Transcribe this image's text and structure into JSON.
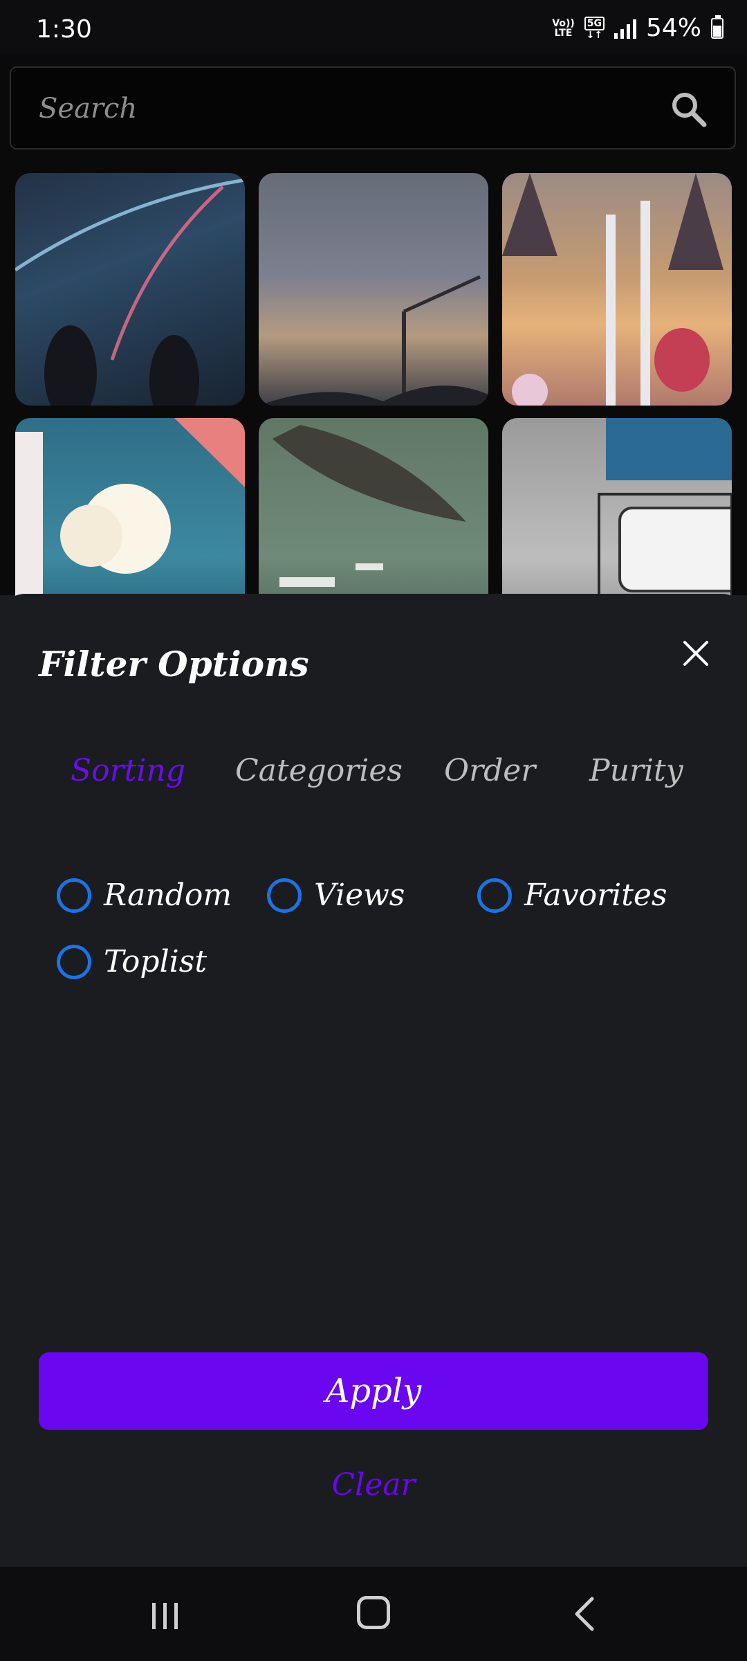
{
  "status_bar": {
    "time": "1:30",
    "volte_label_top": "Vo))",
    "volte_label_bottom": "LTE",
    "network_label": "5G",
    "battery": "54%"
  },
  "search": {
    "placeholder": "Search",
    "icon": "search-icon"
  },
  "sheet": {
    "title": "Filter Options",
    "close_icon": "close-icon",
    "tabs": [
      {
        "label": "Sorting",
        "active": true
      },
      {
        "label": "Categories",
        "active": false
      },
      {
        "label": "Order",
        "active": false
      },
      {
        "label": "Purity",
        "active": false
      }
    ],
    "options": [
      {
        "label": "Random",
        "selected": false
      },
      {
        "label": "Views",
        "selected": false
      },
      {
        "label": "Favorites",
        "selected": false
      },
      {
        "label": "Toplist",
        "selected": false
      }
    ],
    "apply_label": "Apply",
    "clear_label": "Clear"
  },
  "colors": {
    "accent": "#6a06f0",
    "radio": "#1a73e8",
    "sheet_bg": "#1a1c1f"
  },
  "nav": {
    "recent_icon": "recent-apps-icon",
    "home_icon": "home-icon",
    "back_icon": "back-icon"
  }
}
